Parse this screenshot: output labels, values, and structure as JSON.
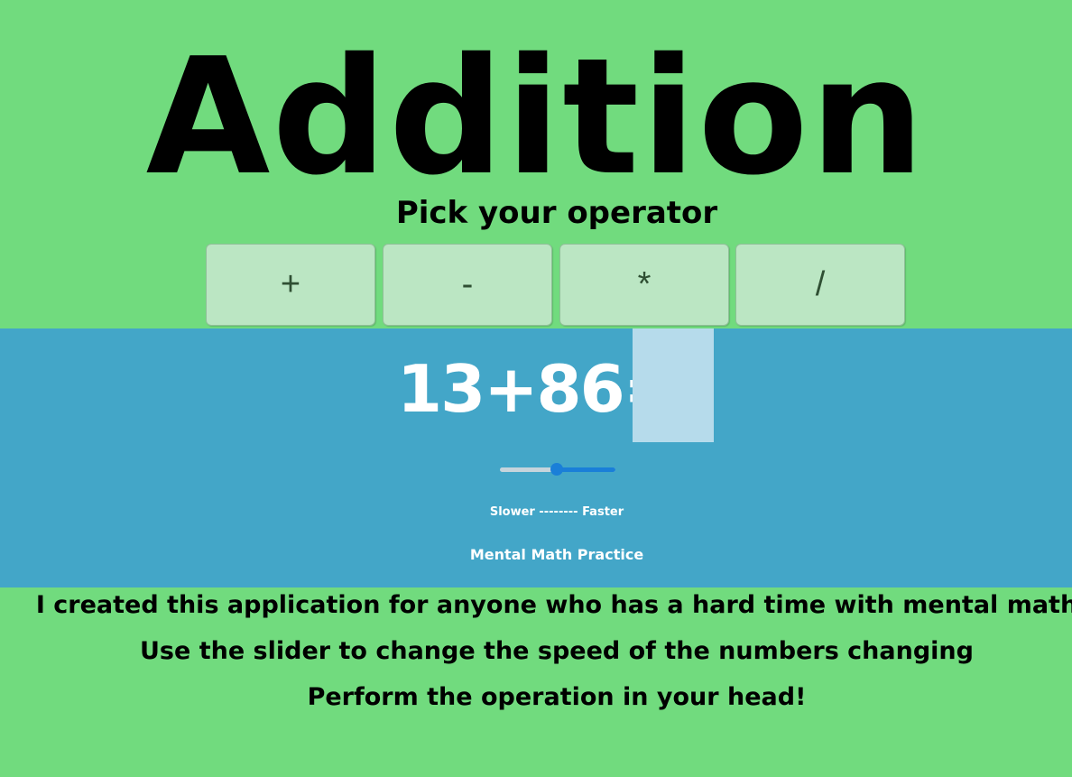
{
  "colors": {
    "green_background": "#71db7e",
    "blue_panel": "#43a6c8",
    "button_bg": "#bbe6c3",
    "answer_box": "#b6dbeb",
    "slider_accent": "#1a7fd8"
  },
  "header": {
    "title": "Addition",
    "subtitle": "Pick your operator"
  },
  "operators": [
    {
      "label": "+"
    },
    {
      "label": "-"
    },
    {
      "label": "*"
    },
    {
      "label": "/"
    }
  ],
  "quiz": {
    "problem": "13+86=",
    "answer_value": ""
  },
  "speed_slider": {
    "value_fraction": 0.49,
    "label": "Slower -------- Faster"
  },
  "app_name": "Mental Math Practice",
  "description": [
    "I created this application for anyone who has a hard time with mental math",
    "Use the slider to change the speed of the numbers changing",
    "Perform the operation in your head!"
  ]
}
